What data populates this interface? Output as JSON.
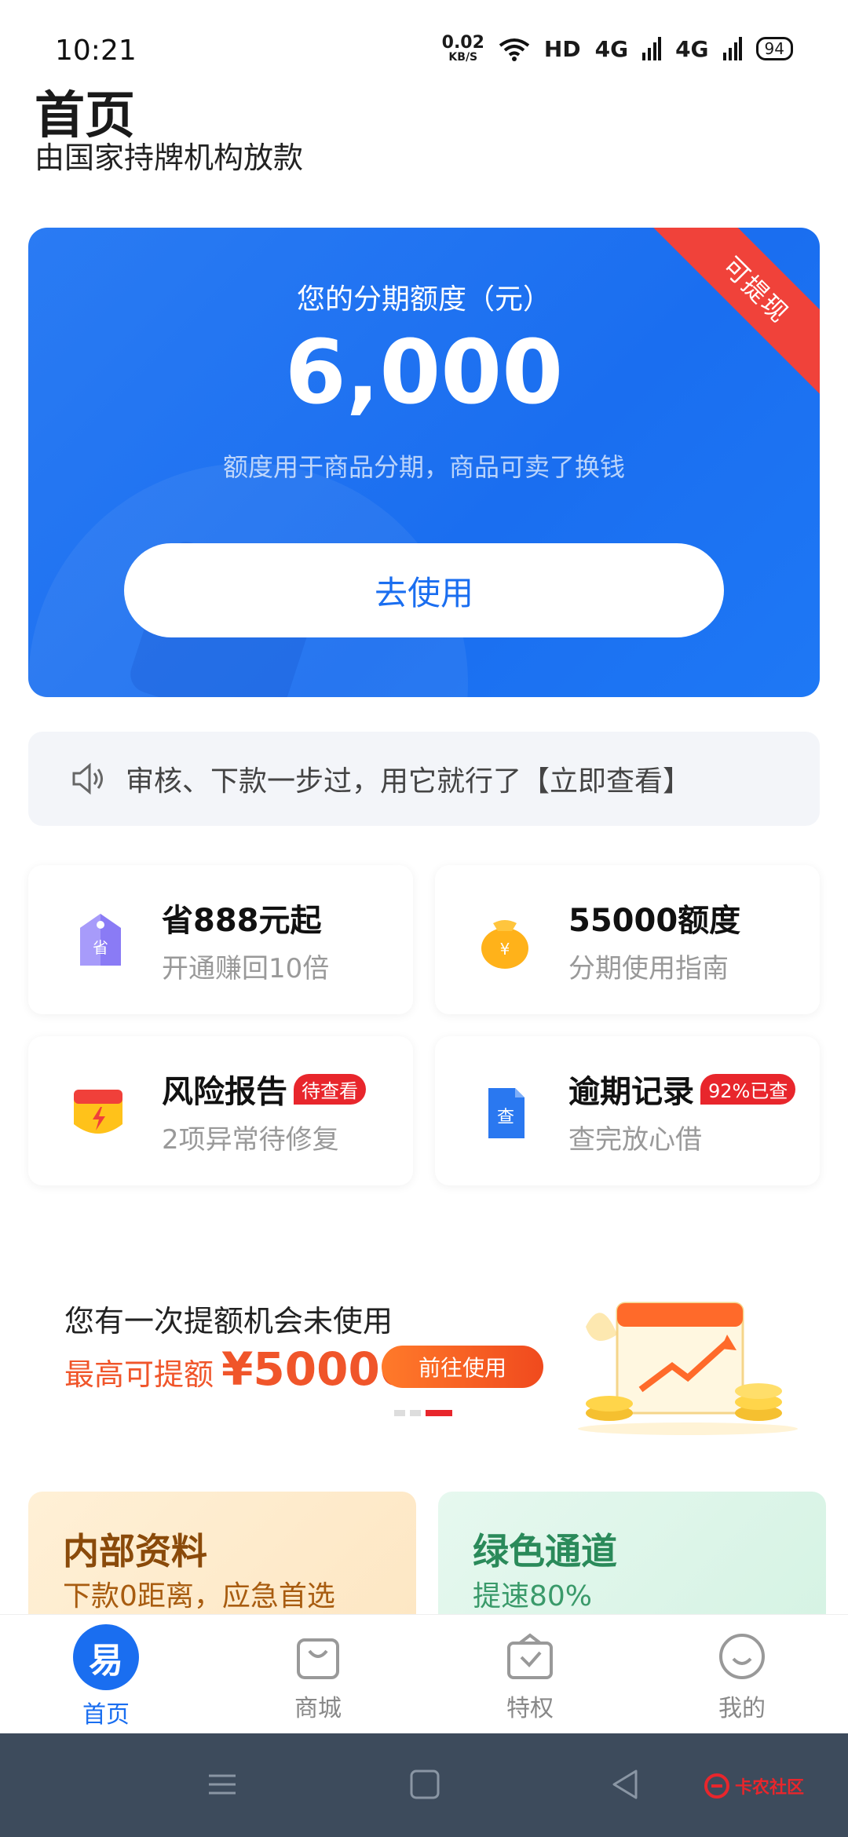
{
  "status_bar": {
    "time": "10:21",
    "net_speed_value": "0.02",
    "net_speed_unit": "KB/S",
    "hd": "HD",
    "sig1": "4G",
    "sig2": "4G",
    "battery": "94"
  },
  "header": {
    "title": "首页",
    "subtitle": "由国家持牌机构放款"
  },
  "credit_card": {
    "ribbon": "可提现",
    "label": "您的分期额度（元）",
    "amount": "6,000",
    "note": "额度用于商品分期，商品可卖了换钱",
    "button": "去使用"
  },
  "notice": {
    "text": "审核、下款一步过，用它就行了【立即查看】"
  },
  "tiles": [
    {
      "title": "省888元起",
      "sub": "开通赚回10倍",
      "icon": "tag-icon",
      "badge": ""
    },
    {
      "title": "55000额度",
      "sub": "分期使用指南",
      "icon": "money-bag-icon",
      "badge": ""
    },
    {
      "title": "风险报告",
      "sub": "2项异常待修复",
      "icon": "shield-icon",
      "badge": "待查看"
    },
    {
      "title": "逾期记录",
      "sub": "查完放心借",
      "icon": "document-icon",
      "badge": "92%已查"
    }
  ],
  "banner": {
    "line1": "您有一次提额机会未使用",
    "line2_prefix": "最高可提额",
    "line2_amount": "¥50000",
    "button": "前往使用"
  },
  "promo_cards": [
    {
      "title": "内部资料",
      "sub": "下款0距离，应急首选"
    },
    {
      "title": "绿色通道",
      "sub": "提速80%"
    }
  ],
  "tabbar": {
    "items": [
      {
        "label": "首页",
        "icon": "home-icon",
        "icon_glyph": "易"
      },
      {
        "label": "商城",
        "icon": "shopping-bag-icon"
      },
      {
        "label": "特权",
        "icon": "privilege-icon"
      },
      {
        "label": "我的",
        "icon": "smiley-icon"
      }
    ]
  },
  "watermark": "卡农社区",
  "colors": {
    "primary": "#1a6ef0",
    "ribbon": "#f0423a",
    "accent_orange": "#f0552a",
    "badge_red": "#e8262c"
  }
}
